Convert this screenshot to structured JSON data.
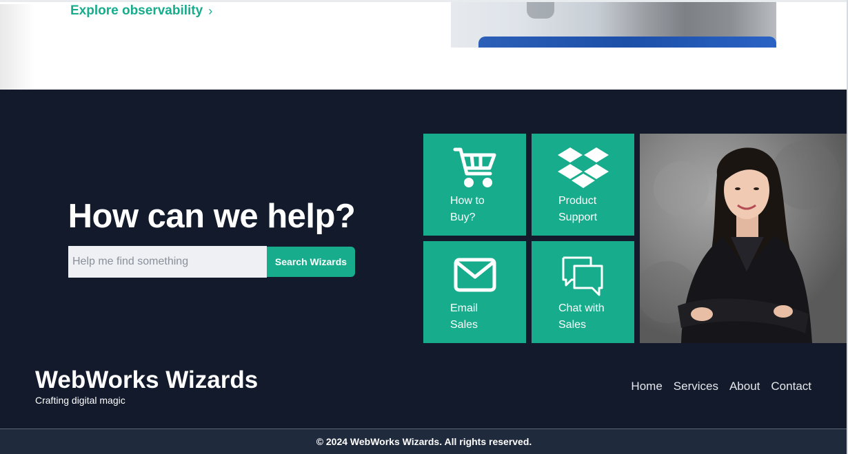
{
  "top": {
    "explore_link": "Explore observability",
    "explore_chevron": "›"
  },
  "help": {
    "title": "How can we help?",
    "search_placeholder": "Help me find something",
    "search_button": "Search Wizards"
  },
  "tiles": [
    {
      "line1": "How to",
      "line2": "Buy?",
      "icon": "cart-icon"
    },
    {
      "line1": "Product",
      "line2": "Support",
      "icon": "dropbox-icon"
    },
    {
      "line1": "Email",
      "line2": "Sales",
      "icon": "envelope-icon"
    },
    {
      "line1": "Chat with",
      "line2": "Sales",
      "icon": "chat-bubbles-icon"
    }
  ],
  "footer": {
    "brand": "WebWorks Wizards",
    "tagline": "Crafting digital magic",
    "nav": [
      "Home",
      "Services",
      "About",
      "Contact"
    ],
    "copyright": "© 2024 WebWorks Wizards. All rights reserved."
  },
  "colors": {
    "accent": "#17ac8c",
    "dark_bg": "#121a2c",
    "bottom_bar": "#1f2a3c"
  }
}
